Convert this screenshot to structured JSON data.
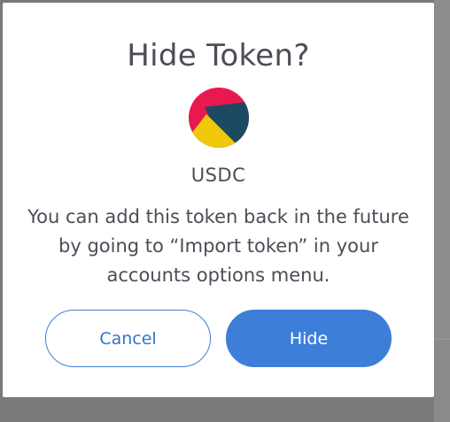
{
  "dialog": {
    "title": "Hide Token?",
    "token_symbol": "USDC",
    "message_lines": [
      "You can add this token back in the future",
      "by going to “Import token” in your",
      "accounts options menu."
    ],
    "cancel_label": "Cancel",
    "hide_label": "Hide"
  },
  "icons": {
    "token_identicon": "token-identicon"
  },
  "colors": {
    "primary_blue": "#3d7fd8",
    "text_gray": "#4a4e55",
    "identicon_red": "#e8194f",
    "identicon_navy": "#1c4a62",
    "identicon_yellow": "#f0c80a"
  }
}
